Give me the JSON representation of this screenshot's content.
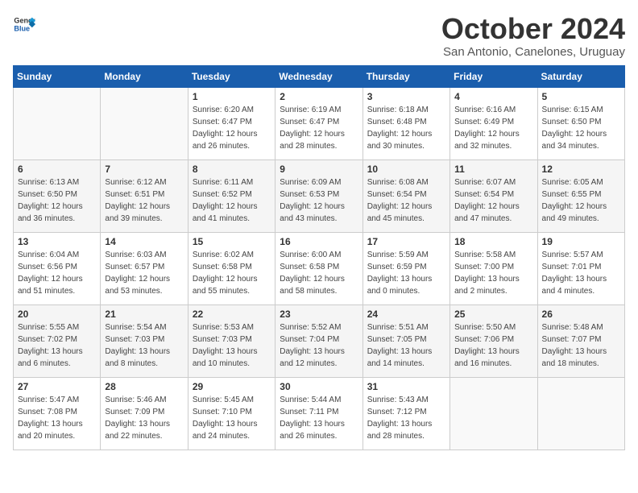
{
  "logo": {
    "general": "General",
    "blue": "Blue"
  },
  "header": {
    "title": "October 2024",
    "subtitle": "San Antonio, Canelones, Uruguay"
  },
  "days_of_week": [
    "Sunday",
    "Monday",
    "Tuesday",
    "Wednesday",
    "Thursday",
    "Friday",
    "Saturday"
  ],
  "weeks": [
    [
      {
        "day": "",
        "info": ""
      },
      {
        "day": "",
        "info": ""
      },
      {
        "day": "1",
        "info": "Sunrise: 6:20 AM\nSunset: 6:47 PM\nDaylight: 12 hours\nand 26 minutes."
      },
      {
        "day": "2",
        "info": "Sunrise: 6:19 AM\nSunset: 6:47 PM\nDaylight: 12 hours\nand 28 minutes."
      },
      {
        "day": "3",
        "info": "Sunrise: 6:18 AM\nSunset: 6:48 PM\nDaylight: 12 hours\nand 30 minutes."
      },
      {
        "day": "4",
        "info": "Sunrise: 6:16 AM\nSunset: 6:49 PM\nDaylight: 12 hours\nand 32 minutes."
      },
      {
        "day": "5",
        "info": "Sunrise: 6:15 AM\nSunset: 6:50 PM\nDaylight: 12 hours\nand 34 minutes."
      }
    ],
    [
      {
        "day": "6",
        "info": "Sunrise: 6:13 AM\nSunset: 6:50 PM\nDaylight: 12 hours\nand 36 minutes."
      },
      {
        "day": "7",
        "info": "Sunrise: 6:12 AM\nSunset: 6:51 PM\nDaylight: 12 hours\nand 39 minutes."
      },
      {
        "day": "8",
        "info": "Sunrise: 6:11 AM\nSunset: 6:52 PM\nDaylight: 12 hours\nand 41 minutes."
      },
      {
        "day": "9",
        "info": "Sunrise: 6:09 AM\nSunset: 6:53 PM\nDaylight: 12 hours\nand 43 minutes."
      },
      {
        "day": "10",
        "info": "Sunrise: 6:08 AM\nSunset: 6:54 PM\nDaylight: 12 hours\nand 45 minutes."
      },
      {
        "day": "11",
        "info": "Sunrise: 6:07 AM\nSunset: 6:54 PM\nDaylight: 12 hours\nand 47 minutes."
      },
      {
        "day": "12",
        "info": "Sunrise: 6:05 AM\nSunset: 6:55 PM\nDaylight: 12 hours\nand 49 minutes."
      }
    ],
    [
      {
        "day": "13",
        "info": "Sunrise: 6:04 AM\nSunset: 6:56 PM\nDaylight: 12 hours\nand 51 minutes."
      },
      {
        "day": "14",
        "info": "Sunrise: 6:03 AM\nSunset: 6:57 PM\nDaylight: 12 hours\nand 53 minutes."
      },
      {
        "day": "15",
        "info": "Sunrise: 6:02 AM\nSunset: 6:58 PM\nDaylight: 12 hours\nand 55 minutes."
      },
      {
        "day": "16",
        "info": "Sunrise: 6:00 AM\nSunset: 6:58 PM\nDaylight: 12 hours\nand 58 minutes."
      },
      {
        "day": "17",
        "info": "Sunrise: 5:59 AM\nSunset: 6:59 PM\nDaylight: 13 hours\nand 0 minutes."
      },
      {
        "day": "18",
        "info": "Sunrise: 5:58 AM\nSunset: 7:00 PM\nDaylight: 13 hours\nand 2 minutes."
      },
      {
        "day": "19",
        "info": "Sunrise: 5:57 AM\nSunset: 7:01 PM\nDaylight: 13 hours\nand 4 minutes."
      }
    ],
    [
      {
        "day": "20",
        "info": "Sunrise: 5:55 AM\nSunset: 7:02 PM\nDaylight: 13 hours\nand 6 minutes."
      },
      {
        "day": "21",
        "info": "Sunrise: 5:54 AM\nSunset: 7:03 PM\nDaylight: 13 hours\nand 8 minutes."
      },
      {
        "day": "22",
        "info": "Sunrise: 5:53 AM\nSunset: 7:03 PM\nDaylight: 13 hours\nand 10 minutes."
      },
      {
        "day": "23",
        "info": "Sunrise: 5:52 AM\nSunset: 7:04 PM\nDaylight: 13 hours\nand 12 minutes."
      },
      {
        "day": "24",
        "info": "Sunrise: 5:51 AM\nSunset: 7:05 PM\nDaylight: 13 hours\nand 14 minutes."
      },
      {
        "day": "25",
        "info": "Sunrise: 5:50 AM\nSunset: 7:06 PM\nDaylight: 13 hours\nand 16 minutes."
      },
      {
        "day": "26",
        "info": "Sunrise: 5:48 AM\nSunset: 7:07 PM\nDaylight: 13 hours\nand 18 minutes."
      }
    ],
    [
      {
        "day": "27",
        "info": "Sunrise: 5:47 AM\nSunset: 7:08 PM\nDaylight: 13 hours\nand 20 minutes."
      },
      {
        "day": "28",
        "info": "Sunrise: 5:46 AM\nSunset: 7:09 PM\nDaylight: 13 hours\nand 22 minutes."
      },
      {
        "day": "29",
        "info": "Sunrise: 5:45 AM\nSunset: 7:10 PM\nDaylight: 13 hours\nand 24 minutes."
      },
      {
        "day": "30",
        "info": "Sunrise: 5:44 AM\nSunset: 7:11 PM\nDaylight: 13 hours\nand 26 minutes."
      },
      {
        "day": "31",
        "info": "Sunrise: 5:43 AM\nSunset: 7:12 PM\nDaylight: 13 hours\nand 28 minutes."
      },
      {
        "day": "",
        "info": ""
      },
      {
        "day": "",
        "info": ""
      }
    ]
  ]
}
